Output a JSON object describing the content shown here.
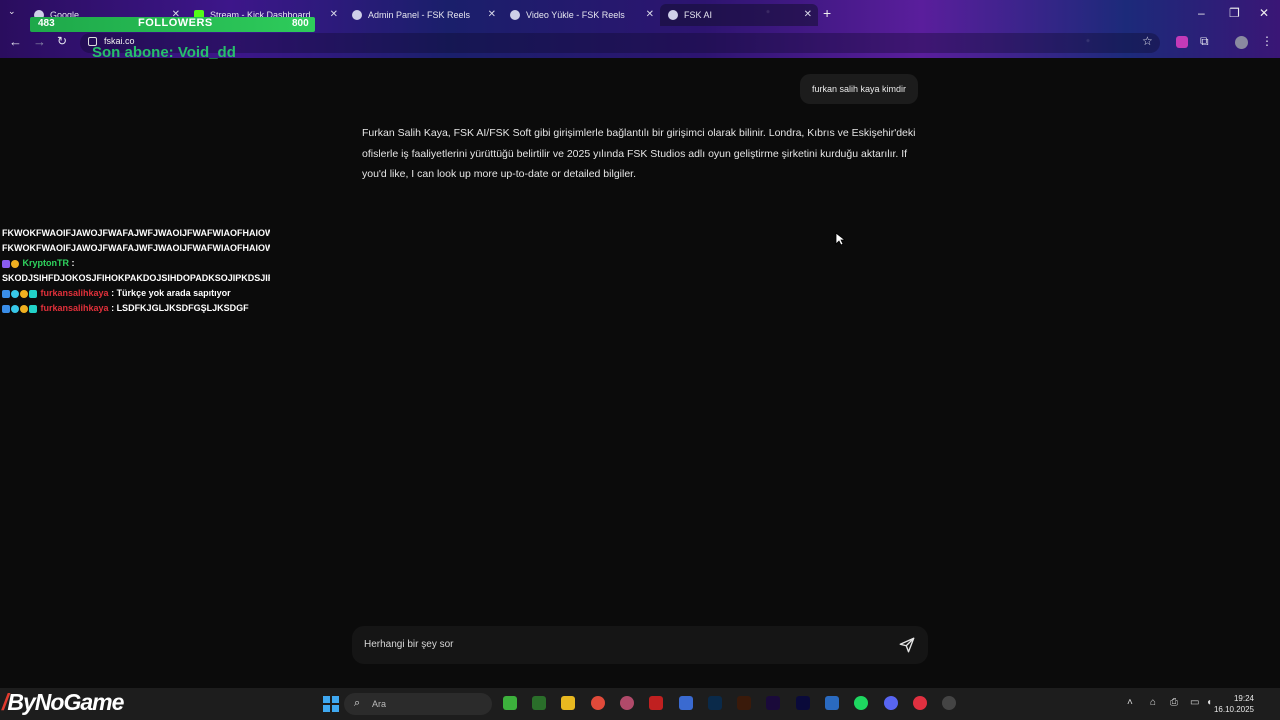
{
  "browser": {
    "tabs": [
      {
        "label": "Google"
      },
      {
        "label": "Stream - Kick Dashboard"
      },
      {
        "label": "Admin Panel - FSK Reels"
      },
      {
        "label": "Video Yükle - FSK Reels"
      },
      {
        "label": "FSK AI"
      }
    ],
    "url": "fskai.co"
  },
  "overlay": {
    "followers_current": "483",
    "followers_label": "FOLLOWERS",
    "followers_goal": "800",
    "last_sub": "Son abone: Void_dd",
    "chat": [
      {
        "text": "FKWOKFWAOIFJAWOJFWAFAJWFJWAOIJFWAFWIAOFHAIOWHFAWOI"
      },
      {
        "text": "FKWOKFWAOIFJAWOJFWAFAJWFJWAOIJFWAFWIAOFHAIOWHFAWOI"
      },
      {
        "user": "KryptonTR",
        "sep": " :"
      },
      {
        "text": "SKODJSIHFDJOKOSJFIHOKPAKDOJSIHDOPADKSOJIPKDSJIPKD"
      },
      {
        "user": "furkansalihkaya",
        "sep": " : ",
        "text": "Türkçe yok arada sapıtıyor"
      },
      {
        "user": "furkansalihkaya",
        "sep": " : ",
        "text": "LSDFKJGLJKSDFGŞLJKSDGF"
      }
    ],
    "brand": "ByNoGame"
  },
  "conversation": {
    "user_message": "furkan salih kaya kimdir",
    "assistant_message": "Furkan Salih Kaya, FSK AI/FSK Soft gibi girişimlerle bağlantılı bir girişimci olarak bilinir. Londra, Kıbrıs ve Eskişehir'deki ofislerle iş faaliyetlerini yürüttüğü belirtilir ve 2025 yılında FSK Studios adlı oyun geliştirme şirketini kurduğu aktarılır. If you'd like, I can look up more up-to-date or detailed bilgiler."
  },
  "composer": {
    "placeholder": "Herhangi bir şey sor"
  },
  "taskbar": {
    "search_label": "Ara",
    "time": "19:24",
    "date": "16.10.2025"
  },
  "colors": {
    "followers_bar": "#2ecc5b",
    "sub_text": "#27c06a",
    "chat_user_green": "#2fd45e",
    "chat_user_red": "#e0303a"
  }
}
